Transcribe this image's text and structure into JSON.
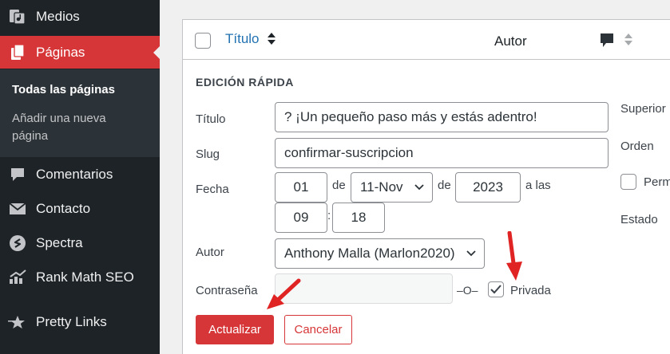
{
  "sidebar": {
    "items": [
      {
        "label": "Medios",
        "icon": "media-icon"
      },
      {
        "label": "Páginas",
        "icon": "pages-icon",
        "active": true
      },
      {
        "label": "Comentarios",
        "icon": "comments-icon"
      },
      {
        "label": "Contacto",
        "icon": "mail-icon"
      },
      {
        "label": "Spectra",
        "icon": "spectra-icon"
      },
      {
        "label": "Rank Math SEO",
        "icon": "chart-icon"
      },
      {
        "label": "Pretty Links",
        "icon": "star-icon"
      }
    ],
    "submenu": {
      "current": "Todas las páginas",
      "add_new_line1": "Añadir una nueva",
      "add_new_line2": "página"
    }
  },
  "table": {
    "col_title": "Título",
    "col_author": "Autor"
  },
  "quick_edit": {
    "heading": "EDICIÓN RÁPIDA",
    "title_label": "Título",
    "title_value": "? ¡Un pequeño paso más y estás adentro!",
    "slug_label": "Slug",
    "slug_value": "confirmar-suscripcion",
    "date_label": "Fecha",
    "day": "01",
    "de1": "de",
    "month": "11-Nov",
    "de2": "de",
    "year": "2023",
    "at": "a las",
    "hour": "09",
    "colon": ":",
    "minute": "18",
    "author_label": "Autor",
    "author_value": "Anthony Malla (Marlon2020)",
    "password_label": "Contraseña",
    "password_value": "",
    "or_text": "–O–",
    "private_label": "Privada",
    "private_checked": true,
    "parent_label": "Superior",
    "order_label": "Orden",
    "perm_label": "Perm",
    "status_label": "Estado",
    "update_button": "Actualizar",
    "cancel_button": "Cancelar"
  },
  "colors": {
    "accent": "#d63638",
    "sidebar_bg": "#1d2327",
    "link": "#2271b1"
  }
}
